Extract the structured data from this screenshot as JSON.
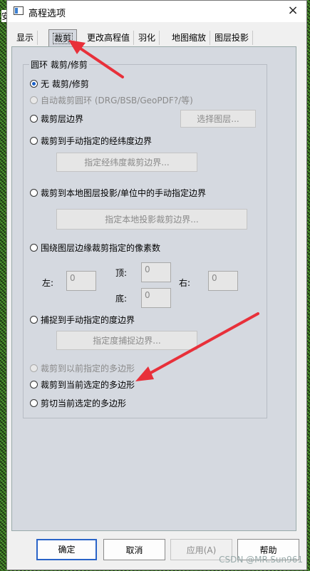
{
  "background": {
    "left_text": "安"
  },
  "window": {
    "title": "高程选项",
    "close": "×"
  },
  "tabs": [
    {
      "label": "显示"
    },
    {
      "label": "裁剪",
      "active": true
    },
    {
      "label": "更改高程值"
    },
    {
      "label": "羽化"
    },
    {
      "label": "地图缩放"
    },
    {
      "label": "图层投影"
    }
  ],
  "crop": {
    "group_title": "圆环 裁剪/修剪",
    "options": [
      {
        "label": "无 裁剪/修剪",
        "checked": true,
        "disabled": false
      },
      {
        "label": "自动裁剪圆环 (DRG/BSB/GeoPDF?/等)",
        "checked": false,
        "disabled": true
      },
      {
        "label": "裁剪层边界",
        "checked": false,
        "disabled": false
      },
      {
        "label": "裁剪到手动指定的经纬度边界",
        "checked": false,
        "disabled": false
      },
      {
        "label": "裁剪到本地图层投影/单位中的手动指定边界",
        "checked": false,
        "disabled": false
      },
      {
        "label": "围绕图层边缘裁剪指定的像素数",
        "checked": false,
        "disabled": false
      },
      {
        "label": "捕捉到手动指定的度边界",
        "checked": false,
        "disabled": false
      },
      {
        "label": "裁剪到以前指定的多边形",
        "checked": false,
        "disabled": true
      },
      {
        "label": "裁剪到当前选定的多边形",
        "checked": false,
        "disabled": false
      },
      {
        "label": "剪切当前选定的多边形",
        "checked": false,
        "disabled": false
      }
    ],
    "buttons": {
      "select_layer": "选择图层...",
      "latlon_bounds": "指定经纬度裁剪边界...",
      "local_bounds": "指定本地投影裁剪边界...",
      "degree_bounds": "指定度捕捉边界..."
    },
    "pixels": {
      "left_label": "左:",
      "left_value": "0",
      "top_label": "顶:",
      "top_value": "0",
      "right_label": "右:",
      "right_value": "0",
      "bottom_label": "底:",
      "bottom_value": "0"
    }
  },
  "footer": {
    "ok": "确定",
    "cancel": "取消",
    "apply": "应用(A)",
    "help": "帮助"
  },
  "watermark": "CSDN @MR.Sun961",
  "colors": {
    "arrow": "#e8303a",
    "accent": "#2a64c8",
    "panel": "#d5d9e0"
  }
}
